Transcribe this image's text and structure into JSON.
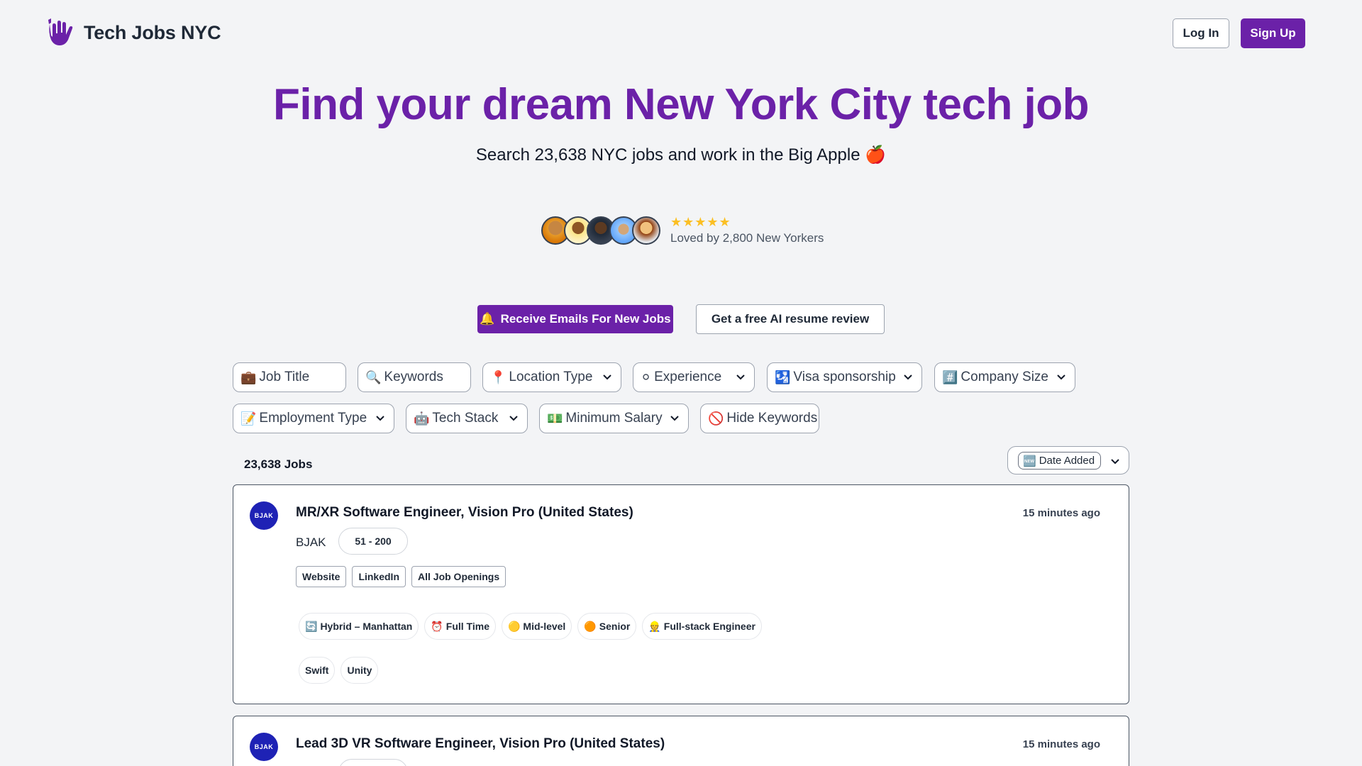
{
  "header": {
    "logo_text": "Tech Jobs NYC",
    "login_label": "Log In",
    "signup_label": "Sign Up"
  },
  "hero": {
    "title": "Find your dream New York City tech job",
    "subtitle": "Search 23,638 NYC jobs and work in the Big Apple 🍎",
    "stars": "★★★★★",
    "loved_text": "Loved by 2,800 New Yorkers"
  },
  "cta": {
    "email_icon": "🔔",
    "email_label": "Receive Emails For New Jobs",
    "resume_label": "Get a free AI resume review"
  },
  "filters": {
    "job_title": {
      "icon": "💼",
      "placeholder": "Job Title"
    },
    "keywords": {
      "icon": "🔍",
      "placeholder": "Keywords"
    },
    "location_type": {
      "icon": "📍",
      "label": "Location Type"
    },
    "experience": {
      "icon": "⚪",
      "label": "Experience"
    },
    "visa": {
      "icon": "🛂",
      "label": "Visa sponsorship"
    },
    "company_size": {
      "icon": "#️⃣",
      "label": "Company Size"
    },
    "employment_type": {
      "icon": "📝",
      "label": "Employment Type"
    },
    "tech_stack": {
      "icon": "🤖",
      "label": "Tech Stack"
    },
    "min_salary": {
      "icon": "💵",
      "label": "Minimum Salary"
    },
    "hide_keywords": {
      "icon": "🚫",
      "label": "Hide Keywords"
    }
  },
  "results": {
    "count": "23,638 Jobs",
    "sort_icon": "🆕",
    "sort_label": "Date Added"
  },
  "jobs": [
    {
      "logo": "BJAK",
      "title": "MR/XR Software Engineer, Vision Pro (United States)",
      "time": "15 minutes ago",
      "company": "BJAK",
      "size": "51 - 200",
      "links": [
        "Website",
        "LinkedIn",
        "All Job Openings"
      ],
      "tags": [
        {
          "icon": "🔄",
          "label": "Hybrid – Manhattan"
        },
        {
          "icon": "⏰",
          "label": "Full Time"
        },
        {
          "icon": "🟡",
          "label": "Mid-level"
        },
        {
          "icon": "🟠",
          "label": "Senior"
        },
        {
          "icon": "👷",
          "label": "Full-stack Engineer"
        }
      ],
      "stack": [
        "Swift",
        "Unity"
      ]
    },
    {
      "logo": "BJAK",
      "title": "Lead 3D VR Software Engineer, Vision Pro (United States)",
      "time": "15 minutes ago"
    }
  ],
  "colors": {
    "brand": "#6b21a8",
    "background": "#f3f4f6",
    "star": "#fbbf24",
    "company_logo": "#1e22b5"
  }
}
